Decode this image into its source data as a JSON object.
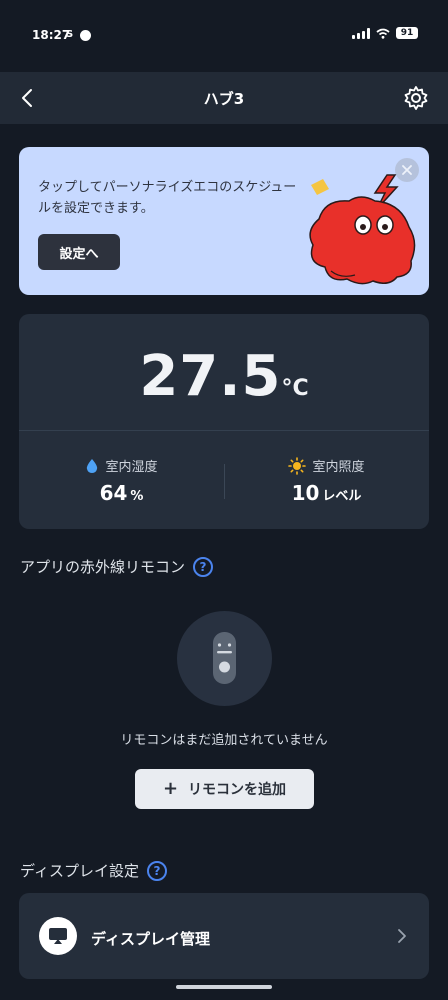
{
  "status_bar": {
    "time": "18:27",
    "indicator": "S",
    "battery": "91"
  },
  "header": {
    "title": "ハブ3",
    "back_icon": "chevron-left-icon",
    "settings_icon": "gear-icon"
  },
  "banner": {
    "text": "タップしてパーソナライズエコのスケジュールを設定できます。",
    "button_label": "設定へ",
    "background": "#c7d9ff",
    "mascot_color": "#e8302a"
  },
  "sensors": {
    "temperature": {
      "value": "27.5",
      "unit": "°C"
    },
    "humidity": {
      "label": "室内湿度",
      "value": "64",
      "unit": "%",
      "icon": "water-drop-icon"
    },
    "illuminance": {
      "label": "室内照度",
      "value": "10",
      "unit": "レベル",
      "icon": "sun-icon"
    }
  },
  "remote_section": {
    "title": "アプリの赤外線リモコン",
    "empty_text": "リモコンはまだ追加されていません",
    "add_button_label": "リモコンを追加"
  },
  "display_section": {
    "title": "ディスプレイ設定",
    "item_label": "ディスプレイ管理"
  },
  "colors": {
    "background": "#141a24",
    "card": "#252e3b",
    "accent": "#4b84ee"
  }
}
